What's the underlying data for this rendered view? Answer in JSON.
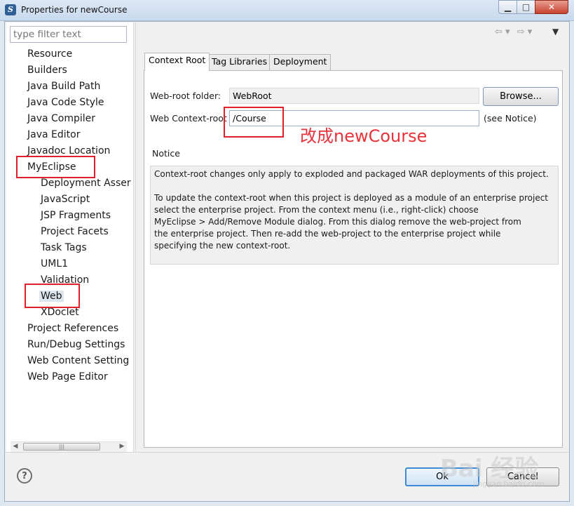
{
  "window": {
    "title": "Properties for newCourse",
    "icon": "myeclipse-icon"
  },
  "left": {
    "filter_placeholder": "type filter text",
    "tree": [
      "Resource",
      "Builders",
      "Java Build Path",
      "Java Code Style",
      "Java Compiler",
      "Java Editor",
      "Javadoc Location",
      "MyEclipse",
      "Deployment Asser",
      "JavaScript",
      "JSP Fragments",
      "Project Facets",
      "Task Tags",
      "UML1",
      "Validation",
      "Web",
      "XDoclet",
      "Project References",
      "Run/Debug Settings",
      "Web Content Setting",
      "Web Page Editor"
    ],
    "selected": "Web"
  },
  "tabs": [
    "Context Root",
    "Tag Libraries",
    "Deployment"
  ],
  "active_tab": "Context Root",
  "form": {
    "webroot_label": "Web-root folder:",
    "webroot_value": "WebRoot",
    "browse_label": "Browse...",
    "context_label": "Web Context-root",
    "context_value": "/Course",
    "see_notice": "(see Notice)",
    "notice_label": "Notice",
    "notice_text": "Context-root changes only apply to exploded and packaged WAR deployments of this project.\n\nTo update the context-root when this project is deployed as a module of an enterprise project\nselect the enterprise project. From the context menu (i.e., right-click) choose\nMyEclipse > Add/Remove Module dialog. From this dialog remove the web-project from\nthe enterprise project. Then re-add the web-project to the enterprise project while\nspecifying the new context-root."
  },
  "annotation": {
    "text": "改成newCourse",
    "color": "#e8323a"
  },
  "buttons": {
    "ok": "Ok",
    "cancel": "Cancel",
    "help": "?"
  },
  "watermark": {
    "text": "Bai 经验",
    "sub": "jingyan.baidu.com"
  },
  "colors": {
    "accent": "#3d8ad6",
    "annotation_box": "#e0202a"
  }
}
